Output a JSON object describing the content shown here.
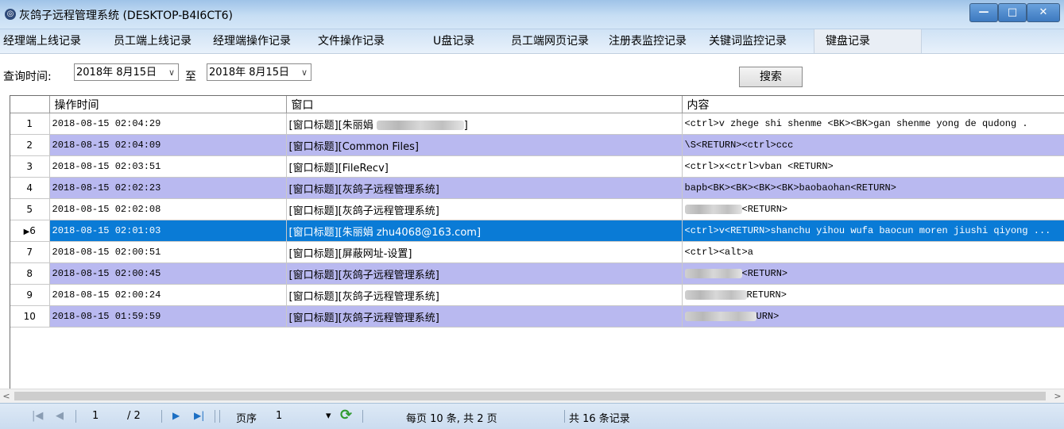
{
  "window": {
    "title": "灰鸽子远程管理系统 (DESKTOP-B4I6CT6)",
    "minimize": "—",
    "maximize": "□",
    "close": "✕"
  },
  "tabs": [
    {
      "label": "经理端上线记录"
    },
    {
      "label": "员工端上线记录"
    },
    {
      "label": "经理端操作记录"
    },
    {
      "label": "文件操作记录"
    },
    {
      "label": "U盘记录"
    },
    {
      "label": "员工端网页记录"
    },
    {
      "label": "注册表监控记录"
    },
    {
      "label": "关键词监控记录"
    },
    {
      "label": "键盘记录"
    }
  ],
  "filter": {
    "query_label": "查询时间:",
    "date_from": "2018年 8月15日",
    "to_label": "至",
    "date_to": "2018年 8月15日",
    "search_label": "搜索"
  },
  "table": {
    "columns": [
      "操作时间",
      "窗口",
      "内容"
    ],
    "rows": [
      {
        "n": "1",
        "time": "2018-08-15 02:04:29",
        "win_pre": "[窗口标题][朱丽娟",
        "win_post": "]",
        "content": "<ctrl>v zhege shi shenme <BK><BK>gan shenme yong de qudong ."
      },
      {
        "n": "2",
        "time": "2018-08-15 02:04:09",
        "win_pre": "[窗口标题][Common Files]",
        "win_post": "",
        "content": "\\S<RETURN><ctrl>ccc"
      },
      {
        "n": "3",
        "time": "2018-08-15 02:03:51",
        "win_pre": "[窗口标题][FileRecv]",
        "win_post": "",
        "content": "<ctrl>x<ctrl>vban <RETURN>"
      },
      {
        "n": "4",
        "time": "2018-08-15 02:02:23",
        "win_pre": "[窗口标题][灰鸽子远程管理系统]",
        "win_post": "",
        "content": "bapb<BK><BK><BK><BK>baobaohan<RETURN>"
      },
      {
        "n": "5",
        "time": "2018-08-15 02:02:08",
        "win_pre": "[窗口标题][灰鸽子远程管理系统]",
        "win_post": "",
        "content": "<RETURN>"
      },
      {
        "n": "6",
        "time": "2018-08-15 02:01:03",
        "win_pre": "[窗口标题][朱丽娟 zhu4068@163.com]",
        "win_post": "",
        "content": "<ctrl>v<RETURN>shanchu yihou wufa baocun  moren jiushi qiyong ..."
      },
      {
        "n": "7",
        "time": "2018-08-15 02:00:51",
        "win_pre": "[窗口标题][屏蔽网址-设置]",
        "win_post": "",
        "content": "<ctrl><alt>a"
      },
      {
        "n": "8",
        "time": "2018-08-15 02:00:45",
        "win_pre": "[窗口标题][灰鸽子远程管理系统]",
        "win_post": "",
        "content": "<RETURN>"
      },
      {
        "n": "9",
        "time": "2018-08-15 02:00:24",
        "win_pre": "[窗口标题][灰鸽子远程管理系统]",
        "win_post": "",
        "content": "RETURN>"
      },
      {
        "n": "10",
        "time": "2018-08-15 01:59:59",
        "win_pre": "[窗口标题][灰鸽子远程管理系统]",
        "win_post": "",
        "content": "URN>"
      }
    ]
  },
  "pager": {
    "first": "|◀",
    "prev": "◀",
    "current_page": "1",
    "total_pages": "/ 2",
    "next": "▶",
    "last": "▶|",
    "page_label": "页序",
    "page_select": "1",
    "page_select_arrow": "▾",
    "refresh": "⟳",
    "per_page": "每页 10 条, 共 2 页",
    "total": "共 16 条记录"
  },
  "scroll": {
    "left": "<",
    "right": ">"
  },
  "colors": {
    "alt_row": "#b9b9f0",
    "selected_row": "#0a7bd6"
  }
}
